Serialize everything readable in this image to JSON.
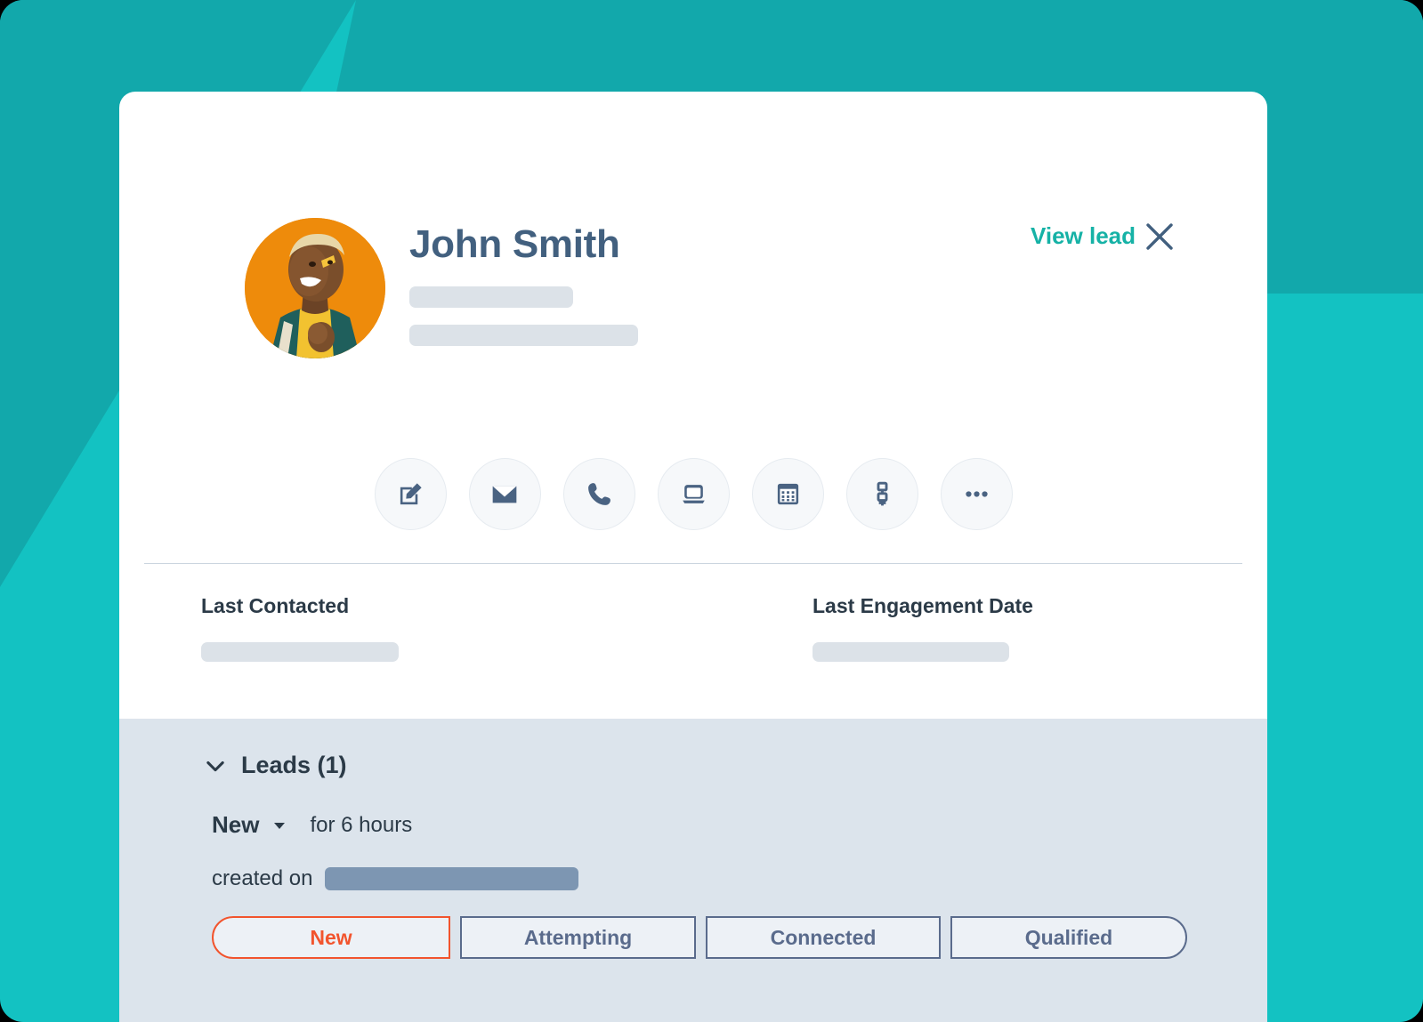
{
  "theme": {
    "teal_light": "#13C2C2",
    "teal_dark": "#12A8AB",
    "card_bg": "#FFFFFF",
    "panel_bg": "#DCE4EC",
    "accent_link": "#16B2A6",
    "name_color": "#42607F",
    "active_stage": "#F2542D",
    "stage_border": "#5A6B8C",
    "avatar_bg": "#EE8B0B"
  },
  "header": {
    "person_name": "John Smith",
    "view_lead_label": "View lead",
    "close_label": "×",
    "avatar_name": "avatar-photo"
  },
  "actions": [
    {
      "name": "note-icon",
      "label": "Note"
    },
    {
      "name": "email-icon",
      "label": "Email"
    },
    {
      "name": "call-icon",
      "label": "Call"
    },
    {
      "name": "log-icon",
      "label": "Log"
    },
    {
      "name": "task-icon",
      "label": "Task"
    },
    {
      "name": "workflow-icon",
      "label": "Enroll in sequence"
    },
    {
      "name": "more-icon",
      "label": "More"
    }
  ],
  "meta": {
    "last_contacted_label": "Last Contacted",
    "last_engagement_label": "Last Engagement Date"
  },
  "leads": {
    "section_title": "Leads (1)",
    "stage_current": "New",
    "duration_text": "for 6 hours",
    "created_on_label": "created on",
    "pipeline": [
      {
        "label": "New",
        "active": true
      },
      {
        "label": "Attempting",
        "active": false
      },
      {
        "label": "Connected",
        "active": false
      },
      {
        "label": "Qualified",
        "active": false
      }
    ]
  }
}
